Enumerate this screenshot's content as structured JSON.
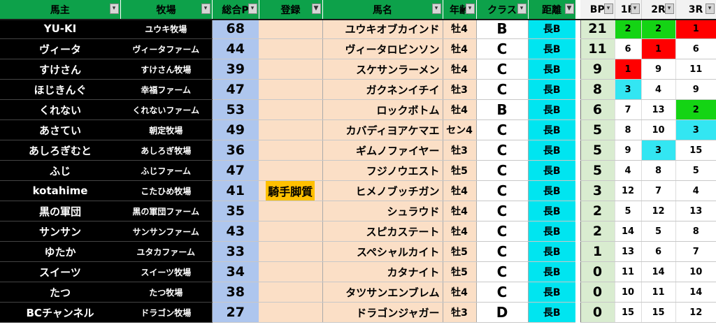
{
  "headers": {
    "owner": "馬主",
    "farm": "牧場",
    "total": "総合P",
    "registration": "登録",
    "horse": "馬名",
    "age": "年齢",
    "class": "クラス",
    "distance": "距離",
    "bp": "BP",
    "r1": "1R",
    "r2": "2R",
    "r3": "3R"
  },
  "filter_icon": "filter-dropdown-icon",
  "colors": {
    "header_green": "#0da14a",
    "owner_black": "#000000",
    "total_blue": "#aec6ee",
    "peach": "#fbdfc6",
    "distance_cyan": "#00e5f0",
    "bp_green": "#d9ecd0",
    "rank1_red": "#ff0000",
    "rank2_green": "#14d414",
    "rank3_cyan": "#33e6f2",
    "tag_orange": "#ffc000"
  },
  "rows": [
    {
      "owner": "YU-KI",
      "farm": "ユウキ牧場",
      "total": "68",
      "reg": "",
      "horse": "ユウキオブカインド",
      "age": "牡4",
      "class": "B",
      "distance": "長B",
      "bp": "21",
      "r1": "2",
      "r2": "2",
      "r3": "1"
    },
    {
      "owner": "ヴィータ",
      "farm": "ヴィータファーム",
      "total": "44",
      "reg": "",
      "horse": "ヴィータロビンソン",
      "age": "牡4",
      "class": "C",
      "distance": "長B",
      "bp": "11",
      "r1": "6",
      "r2": "1",
      "r3": "6"
    },
    {
      "owner": "すけさん",
      "farm": "すけさん牧場",
      "total": "39",
      "reg": "",
      "horse": "スケサンラーメン",
      "age": "牡4",
      "class": "C",
      "distance": "長B",
      "bp": "9",
      "r1": "1",
      "r2": "9",
      "r3": "11"
    },
    {
      "owner": "ほじきんぐ",
      "farm": "幸福ファーム",
      "total": "47",
      "reg": "",
      "horse": "ガクネンイチイ",
      "age": "牡3",
      "class": "C",
      "distance": "長B",
      "bp": "8",
      "r1": "3",
      "r2": "4",
      "r3": "9"
    },
    {
      "owner": "くれない",
      "farm": "くれないファーム",
      "total": "53",
      "reg": "",
      "horse": "ロックボトム",
      "age": "牡4",
      "class": "B",
      "distance": "長B",
      "bp": "6",
      "r1": "7",
      "r2": "13",
      "r3": "2"
    },
    {
      "owner": "あさてい",
      "farm": "朝定牧場",
      "total": "49",
      "reg": "",
      "horse": "カバディヨアケマエ",
      "age": "セン4",
      "class": "C",
      "distance": "長B",
      "bp": "5",
      "r1": "8",
      "r2": "10",
      "r3": "3"
    },
    {
      "owner": "あしろぎむと",
      "farm": "あしろぎ牧場",
      "total": "36",
      "reg": "",
      "horse": "ギムノファイヤー",
      "age": "牡3",
      "class": "C",
      "distance": "長B",
      "bp": "5",
      "r1": "9",
      "r2": "3",
      "r3": "15"
    },
    {
      "owner": "ふじ",
      "farm": "ふじファーム",
      "total": "47",
      "reg": "",
      "horse": "フジノウエスト",
      "age": "牡5",
      "class": "C",
      "distance": "長B",
      "bp": "5",
      "r1": "4",
      "r2": "8",
      "r3": "5"
    },
    {
      "owner": "kotahime",
      "farm": "こたひめ牧場",
      "total": "41",
      "reg": "騎手脚質",
      "horse": "ヒメノブッチガン",
      "age": "牡4",
      "class": "C",
      "distance": "長B",
      "bp": "3",
      "r1": "12",
      "r2": "7",
      "r3": "4"
    },
    {
      "owner": "黒の軍団",
      "farm": "黒の軍団ファーム",
      "total": "35",
      "reg": "",
      "horse": "シュラウド",
      "age": "牡4",
      "class": "C",
      "distance": "長B",
      "bp": "2",
      "r1": "5",
      "r2": "12",
      "r3": "13"
    },
    {
      "owner": "サンサン",
      "farm": "サンサンファーム",
      "total": "43",
      "reg": "",
      "horse": "スピカステート",
      "age": "牡4",
      "class": "C",
      "distance": "長B",
      "bp": "2",
      "r1": "14",
      "r2": "5",
      "r3": "8"
    },
    {
      "owner": "ゆたか",
      "farm": "ユタカファーム",
      "total": "33",
      "reg": "",
      "horse": "スペシャルカイト",
      "age": "牡5",
      "class": "C",
      "distance": "長B",
      "bp": "1",
      "r1": "13",
      "r2": "6",
      "r3": "7"
    },
    {
      "owner": "スイーツ",
      "farm": "スイーツ牧場",
      "total": "34",
      "reg": "",
      "horse": "カタナイト",
      "age": "牡5",
      "class": "C",
      "distance": "長B",
      "bp": "0",
      "r1": "11",
      "r2": "14",
      "r3": "10"
    },
    {
      "owner": "たつ",
      "farm": "たつ牧場",
      "total": "38",
      "reg": "",
      "horse": "タツサンエンブレム",
      "age": "牡4",
      "class": "C",
      "distance": "長B",
      "bp": "0",
      "r1": "10",
      "r2": "11",
      "r3": "14"
    },
    {
      "owner": "BCチャンネル",
      "farm": "ドラゴン牧場",
      "total": "27",
      "reg": "",
      "horse": "ドラゴンジャガー",
      "age": "牡3",
      "class": "D",
      "distance": "長B",
      "bp": "0",
      "r1": "15",
      "r2": "15",
      "r3": "12"
    }
  ]
}
